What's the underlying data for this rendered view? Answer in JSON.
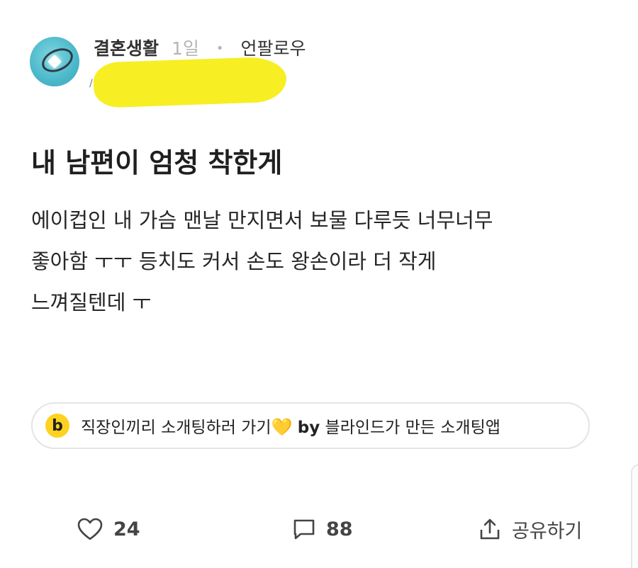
{
  "header": {
    "board": "결혼생활",
    "time": "1일",
    "separator": "•",
    "company": "언팔로우",
    "avatar_icon": "ring-icon",
    "redaction_color": "#f7ee24"
  },
  "post": {
    "title": "내 남편이 엄청 착한게",
    "body_lines": [
      "에이컵인 내 가슴 맨날 만지면서 보물 다루듯 너무너무",
      "좋아함 ㅜㅜ 등치도 커서 손도 왕손이라 더 작게",
      "느껴질텐데 ㅜ"
    ]
  },
  "promo": {
    "logo": "b",
    "text": "직장인끼리 소개팅하러 가기",
    "heart": "💛",
    "by": "by",
    "suffix": "블라인드가 만든 소개팅앱",
    "accent": "#ffd21f"
  },
  "actions": {
    "like_count": "24",
    "comment_count": "88",
    "share_label": "공유하기"
  }
}
